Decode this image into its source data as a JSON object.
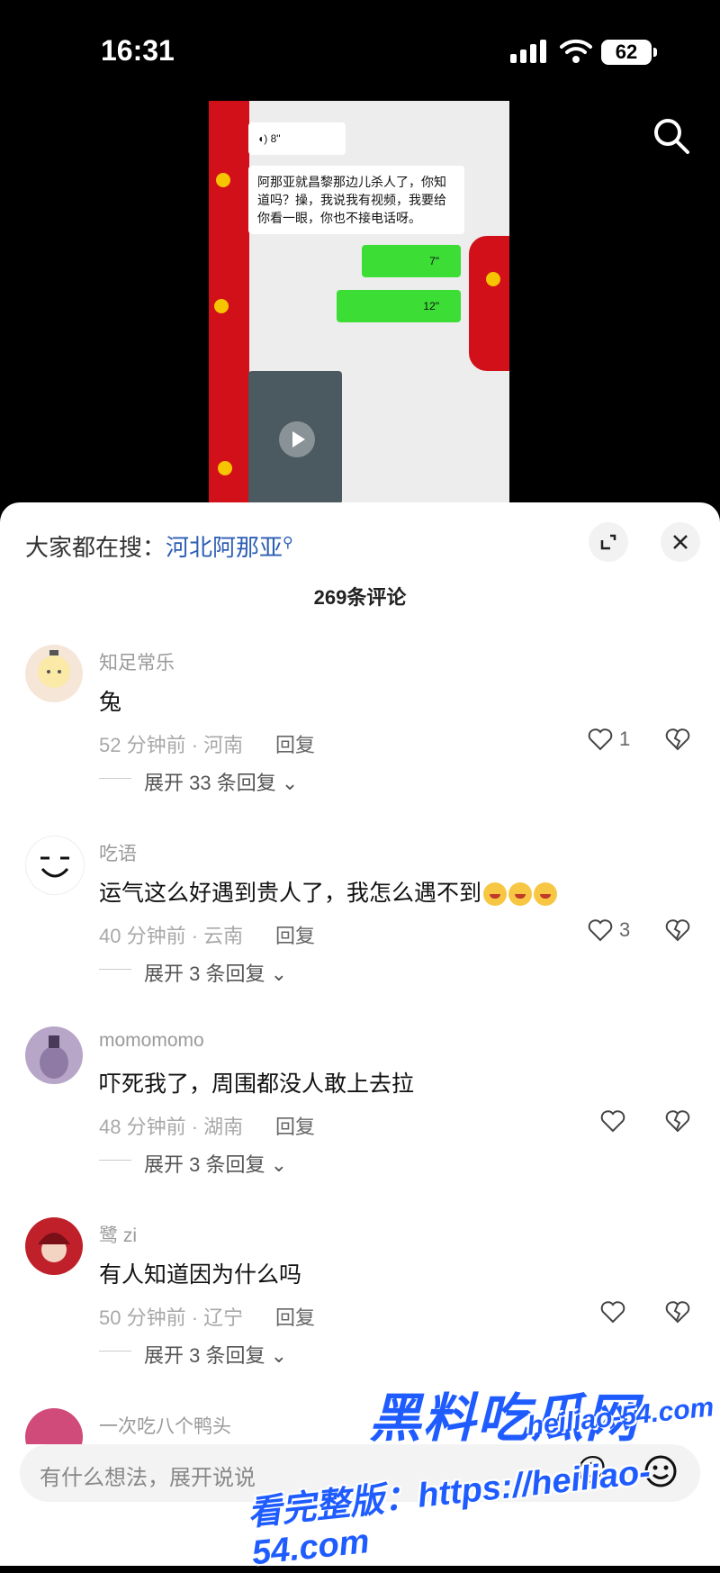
{
  "status": {
    "time": "16:31",
    "battery": "62"
  },
  "video": {
    "voice_left": "8\"",
    "message": "阿那亚就昌黎那边儿杀人了，你知道吗？操，我说我有视频，我要给你看一眼，你也不接电话呀。",
    "voice_right_1": "7\"",
    "voice_right_2": "12\""
  },
  "sheet": {
    "search_prefix": "大家都在搜：",
    "search_keyword": "河北阿那亚",
    "comment_count": "269条评论"
  },
  "comments": [
    {
      "user": "知足常乐",
      "text": "兔",
      "time_loc": "52 分钟前 · 河南",
      "reply": "回复",
      "likes": "1",
      "expand": "展开 33 条回复"
    },
    {
      "user": "吃语",
      "text": "运气这么好遇到贵人了，我怎么遇不到",
      "time_loc": "40 分钟前 · 云南",
      "reply": "回复",
      "likes": "3",
      "expand": "展开 3 条回复"
    },
    {
      "user": "momomomo",
      "text": "吓死我了，周围都没人敢上去拉",
      "time_loc": "48 分钟前 · 湖南",
      "reply": "回复",
      "likes": "",
      "expand": "展开 3 条回复"
    },
    {
      "user": "鹭 zi",
      "text": "有人知道因为什么吗",
      "time_loc": "50 分钟前 · 辽宁",
      "reply": "回复",
      "likes": "",
      "expand": "展开 3 条回复"
    },
    {
      "user": "一次吃八个鸭头"
    }
  ],
  "input": {
    "placeholder": "有什么想法，展开说说"
  },
  "watermark": {
    "brand": "黑料吃瓜网",
    "url": "heiliao-54.com",
    "full": "看完整版：https://heiliao-54.com"
  },
  "colors": {
    "accent": "#2d5fb4",
    "watermark": "#1f5cff",
    "chat_green": "#3cde36"
  }
}
